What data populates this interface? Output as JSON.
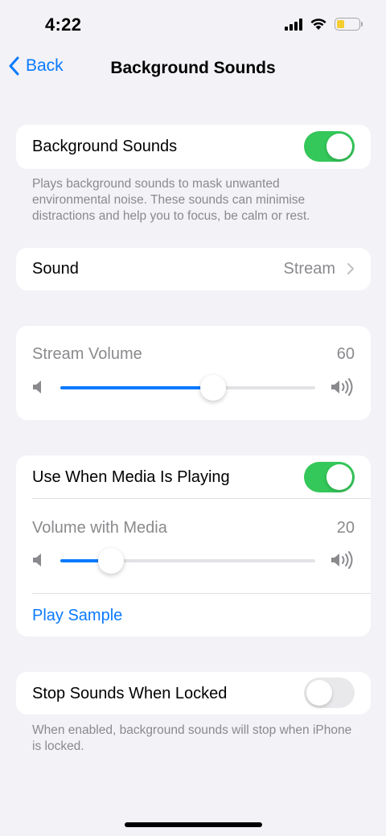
{
  "status_bar": {
    "time": "4:22"
  },
  "nav": {
    "back_label": "Back",
    "title": "Background Sounds"
  },
  "background_sounds": {
    "label": "Background Sounds",
    "enabled": true,
    "footer": "Plays background sounds to mask unwanted environmental noise. These sounds can minimise distractions and help you to focus, be calm or rest."
  },
  "sound": {
    "label": "Sound",
    "value": "Stream"
  },
  "stream_volume": {
    "label": "Stream Volume",
    "value": "60",
    "level": 0.6
  },
  "media": {
    "label": "Use When Media Is Playing",
    "enabled": true,
    "volume_label": "Volume with Media",
    "volume_value": "20",
    "volume_level": 0.2,
    "play_sample": "Play Sample"
  },
  "locked": {
    "label": "Stop Sounds When Locked",
    "enabled": false,
    "footer": "When enabled, background sounds will stop when iPhone is locked."
  },
  "colors": {
    "accent": "#0a7aff",
    "toggle_on": "#34c759",
    "toggle_off": "#e9e9eb",
    "background": "#f2f2f7"
  },
  "icons": [
    "cellular-signal-icon",
    "wifi-icon",
    "battery-icon",
    "chevron-left-icon",
    "chevron-right-icon",
    "speaker-low-icon",
    "speaker-high-icon"
  ]
}
